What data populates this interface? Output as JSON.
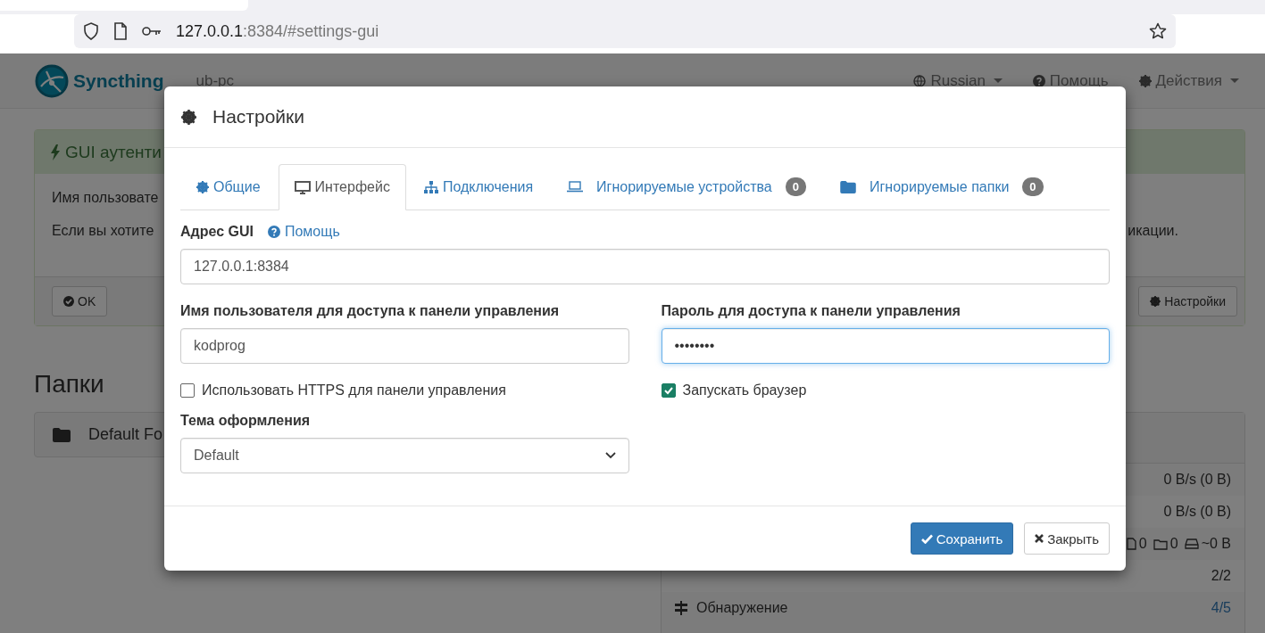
{
  "browser": {
    "url_host": "127.0.0.1",
    "url_rest": ":8384/#settings-gui"
  },
  "navbar": {
    "brand": "Syncthing",
    "device": "ub-pc",
    "menus": [
      {
        "label": "Russian",
        "kind": "language",
        "dropdown": true
      },
      {
        "label": "Помощь",
        "kind": "help",
        "dropdown": false
      },
      {
        "label": "Действия",
        "kind": "actions",
        "dropdown": true
      }
    ]
  },
  "notice": {
    "title": "GUI аутенти",
    "lines": [
      "Имя пользовате",
      "Если вы хотите"
    ],
    "line_end": "икации.",
    "buttons": [
      {
        "label": "OK",
        "kind": "ok"
      },
      {
        "label": "Настройки",
        "kind": "settings"
      }
    ]
  },
  "folders": {
    "heading": "Папки",
    "items": [
      {
        "name": "Default Fo"
      }
    ]
  },
  "device_stats": {
    "rows": [
      {
        "kind": "rate",
        "value": "0 B/s (0 B)"
      },
      {
        "kind": "rate",
        "value": "0 B/s (0 B)"
      },
      {
        "kind": "counts",
        "files": "0",
        "dirs": "0",
        "size": "~0 B"
      },
      {
        "kind": "listeners",
        "value": "2/2",
        "highlight": false
      },
      {
        "kind": "discovery",
        "label": "Обнаружение",
        "value": "4/5",
        "highlight": true
      }
    ]
  },
  "dialog": {
    "title": "Настройки",
    "tabs": [
      {
        "label": "Общие",
        "kind": "general",
        "selected": false
      },
      {
        "label": "Интерфейс",
        "kind": "gui",
        "selected": true
      },
      {
        "label": "Подключения",
        "kind": "connections",
        "selected": false
      },
      {
        "label": "Игнорируемые устройства",
        "kind": "devices",
        "count": "0",
        "selected": false
      },
      {
        "label": "Игнорируемые папки",
        "kind": "folders",
        "count": "0",
        "selected": false
      }
    ],
    "gui_address": {
      "label": "Адрес GUI",
      "help": "Помощь",
      "value": "127.0.0.1:8384"
    },
    "username": {
      "label": "Имя пользователя для доступа к панели управления",
      "value": "kodprog",
      "focused": false
    },
    "password": {
      "label": "Пароль для доступа к панели управления",
      "value": "••••••••",
      "focused": true
    },
    "https": {
      "label": "Использовать HTTPS для панели управления",
      "checked": false
    },
    "launch_browser": {
      "label": "Запускать браузер",
      "checked": true
    },
    "theme": {
      "label": "Тема оформления",
      "value": "Default"
    },
    "buttons": [
      {
        "label": "Сохранить",
        "kind": "primary"
      },
      {
        "label": "Закрыть",
        "kind": "default"
      }
    ]
  }
}
